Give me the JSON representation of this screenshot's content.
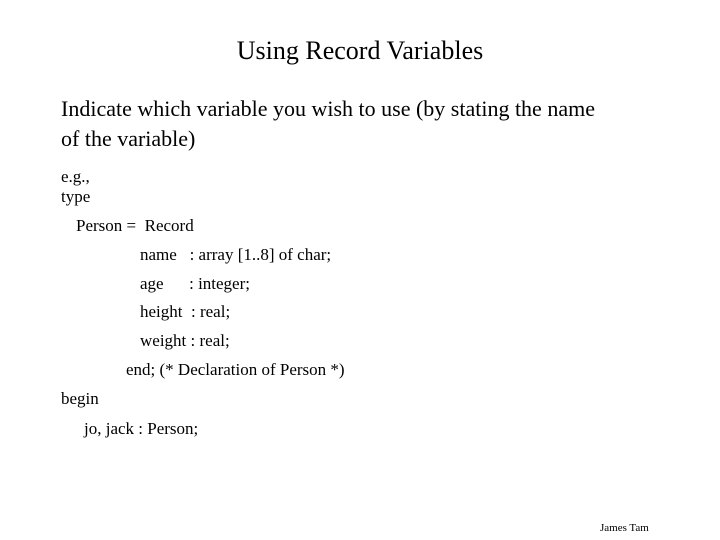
{
  "slide": {
    "title": "Using Record Variables",
    "intro_line1": "Indicate which variable you wish to use (by stating the name",
    "intro_line2": "of the variable)",
    "code": {
      "eg": "e.g.,",
      "type_kw": "type",
      "record_decl": "Person =  Record",
      "field_name": "name   : array [1..8] of char;",
      "field_age": "age      : integer;",
      "field_height": "height  : real;",
      "field_weight": "weight : real;",
      "end_decl": "end; (* Declaration of Person *)",
      "begin_kw": "begin",
      "var_decl": "jo, jack : Person;"
    },
    "footer": "James Tam"
  }
}
